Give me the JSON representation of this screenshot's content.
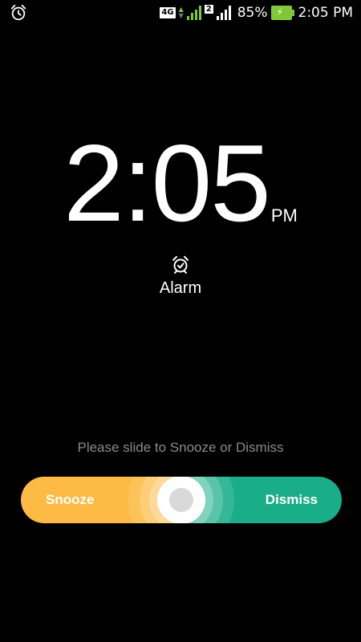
{
  "status_bar": {
    "left_icon": "alarm-clock-icon",
    "network_type": "4G",
    "sim2_label": "2",
    "battery_percent": "85%",
    "battery_level": 0.85,
    "time": "2:05 PM",
    "colors": {
      "signal_active": "#7ec83a",
      "battery": "#7ec83a"
    }
  },
  "clock": {
    "time": "2:05",
    "ampm": "PM"
  },
  "alarm": {
    "icon": "alarm-clock-icon",
    "label": "Alarm"
  },
  "slider": {
    "hint": "Please slide to Snooze or Dismiss",
    "snooze_label": "Snooze",
    "dismiss_label": "Dismiss",
    "colors": {
      "snooze": "#fdbb45",
      "dismiss": "#1aae88",
      "knob": "#ffffff"
    }
  }
}
